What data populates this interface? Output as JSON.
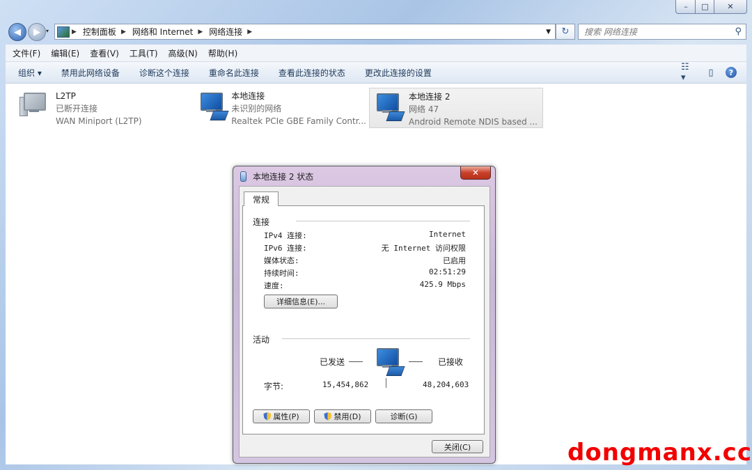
{
  "window": {
    "minimize": "–",
    "maximize": "□",
    "close": "✕"
  },
  "nav": {
    "back": "◀",
    "forward": "▶",
    "breadcrumb": [
      "控制面板",
      "网络和 Internet",
      "网络连接"
    ],
    "search_placeholder": "搜索 网络连接"
  },
  "menu": [
    "文件(F)",
    "编辑(E)",
    "查看(V)",
    "工具(T)",
    "高级(N)",
    "帮助(H)"
  ],
  "commands": [
    "组织 ▾",
    "禁用此网络设备",
    "诊断这个连接",
    "重命名此连接",
    "查看此连接的状态",
    "更改此连接的设置"
  ],
  "connections": [
    {
      "name": "L2TP",
      "status": "已断开连接",
      "device": "WAN Miniport (L2TP)",
      "icon": "vpn-computer-icon"
    },
    {
      "name": "本地连接",
      "status": "未识别的网络",
      "device": "Realtek PCIe GBE Family Contr...",
      "icon": "network-computer-icon"
    },
    {
      "name": "本地连接 2",
      "status": "网络  47",
      "device": "Android Remote NDIS based ...",
      "icon": "network-computer-icon"
    }
  ],
  "dialog": {
    "title": "本地连接 2 状态",
    "close": "✕",
    "tab": "常规",
    "connection_heading": "连接",
    "rows": [
      {
        "label": "IPv4 连接:",
        "value": "Internet"
      },
      {
        "label": "IPv6 连接:",
        "value": "无 Internet 访问权限"
      },
      {
        "label": "媒体状态:",
        "value": "已启用"
      },
      {
        "label": "持续时间:",
        "value": "02:51:29"
      },
      {
        "label": "速度:",
        "value": "425.9 Mbps"
      }
    ],
    "details_button": "详细信息(E)...",
    "activity_heading": "活动",
    "sent_label": "已发送",
    "received_label": "已接收",
    "bytes_label": "字节:",
    "bytes_sent": "15,454,862",
    "bytes_received": "48,204,603",
    "properties_button": "属性(P)",
    "disable_button": "禁用(D)",
    "diagnose_button": "诊断(G)",
    "close_button": "关闭(C)"
  },
  "watermark": "dongmanx.cc"
}
